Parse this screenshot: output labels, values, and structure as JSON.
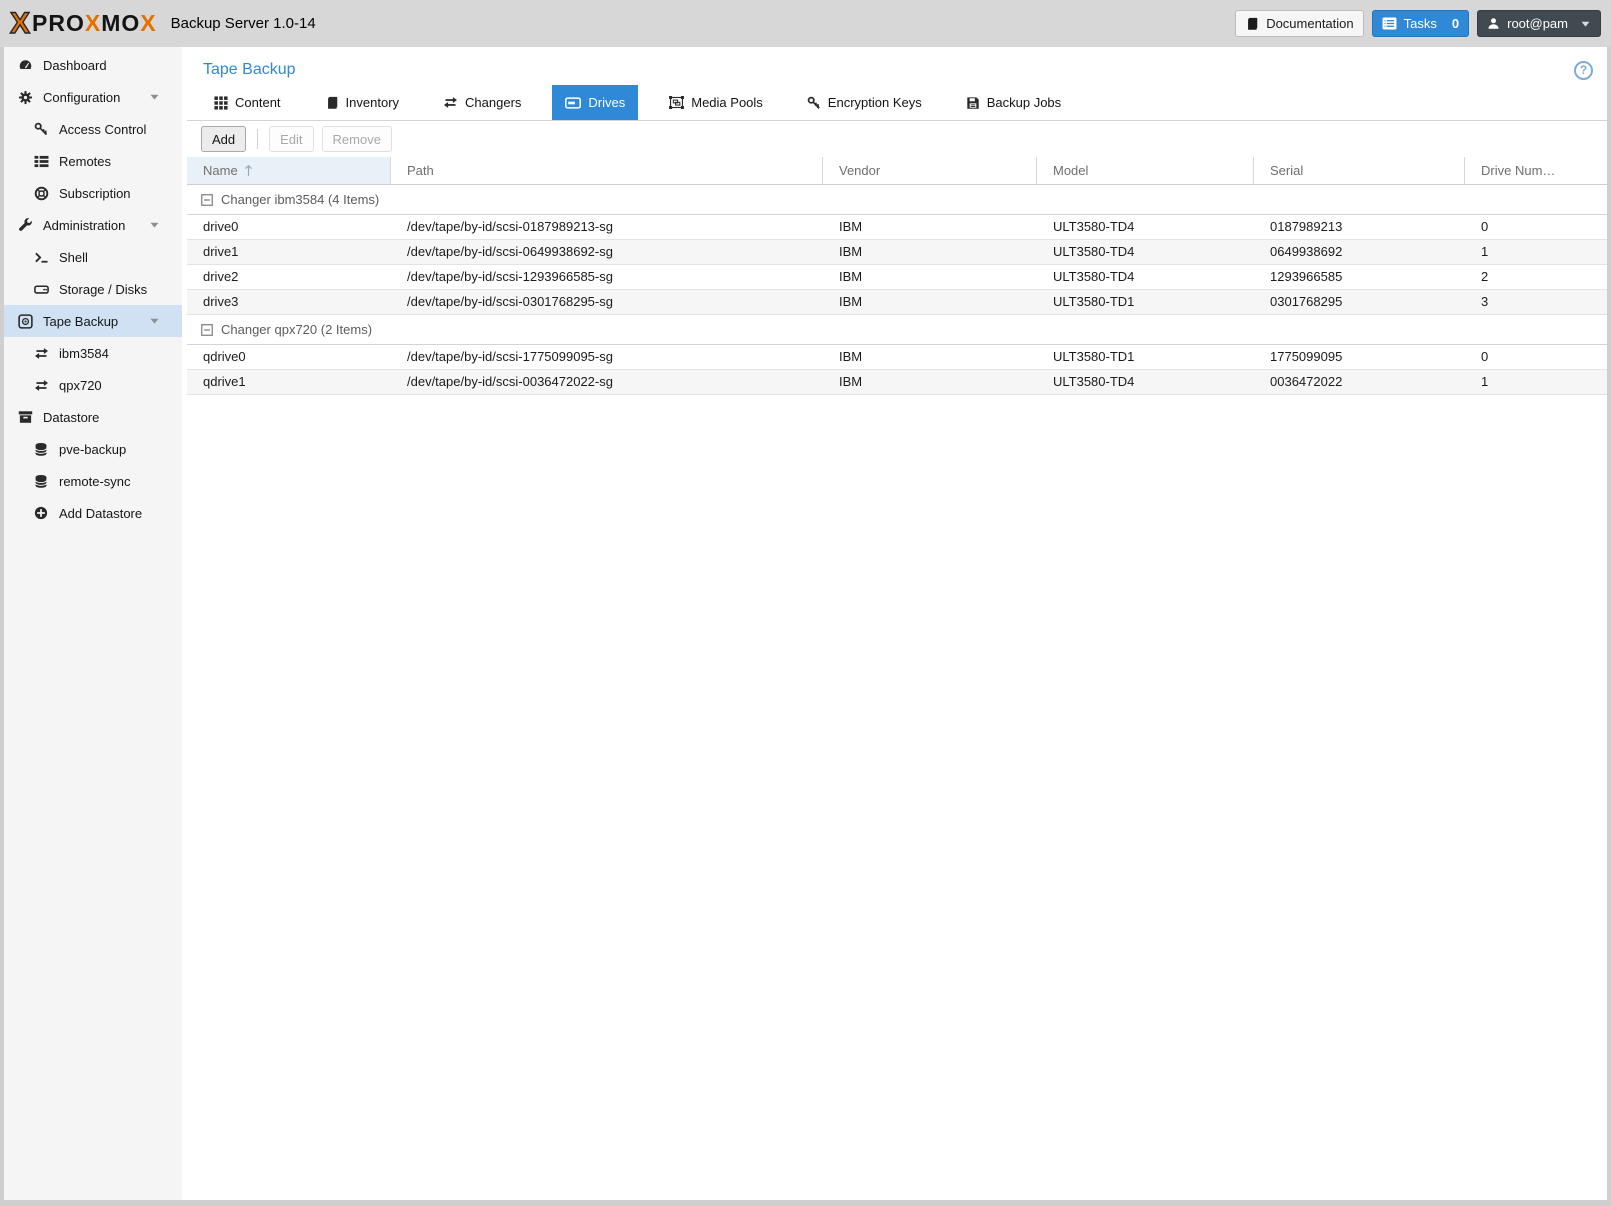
{
  "colors": {
    "accent_blue": "#2f89d6",
    "brand_orange": "#e57000",
    "sidebar_selected": "#cfe1f2"
  },
  "header": {
    "logo_parts": {
      "mark": "X",
      "p1": "PRO",
      "x1": "X",
      "p2": "MO",
      "x2": "X"
    },
    "title": "Backup Server 1.0-14",
    "documentation_label": "Documentation",
    "tasks_label": "Tasks",
    "tasks_count": "0",
    "user_label": "root@pam"
  },
  "sidebar": {
    "items": [
      {
        "label": "Dashboard",
        "icon": "tachometer-icon"
      },
      {
        "label": "Configuration",
        "icon": "cogs-icon"
      },
      {
        "label": "Access Control",
        "icon": "key-icon"
      },
      {
        "label": "Remotes",
        "icon": "list-icon"
      },
      {
        "label": "Subscription",
        "icon": "support-icon"
      },
      {
        "label": "Administration",
        "icon": "wrench-icon"
      },
      {
        "label": "Shell",
        "icon": "terminal-icon"
      },
      {
        "label": "Storage / Disks",
        "icon": "hdd-icon"
      },
      {
        "label": "Tape Backup",
        "icon": "tape-cartridge-icon",
        "selected": true
      },
      {
        "label": "ibm3584",
        "icon": "exchange-icon"
      },
      {
        "label": "qpx720",
        "icon": "exchange-icon"
      },
      {
        "label": "Datastore",
        "icon": "archive-icon"
      },
      {
        "label": "pve-backup",
        "icon": "database-icon"
      },
      {
        "label": "remote-sync",
        "icon": "database-icon"
      },
      {
        "label": "Add Datastore",
        "icon": "plus-circle-icon"
      }
    ]
  },
  "main": {
    "title": "Tape Backup",
    "tabs": [
      {
        "label": "Content",
        "icon": "grid-icon"
      },
      {
        "label": "Inventory",
        "icon": "book-icon"
      },
      {
        "label": "Changers",
        "icon": "exchange-icon"
      },
      {
        "label": "Drives",
        "icon": "tape-drive-icon",
        "selected": true
      },
      {
        "label": "Media Pools",
        "icon": "object-group-icon"
      },
      {
        "label": "Encryption Keys",
        "icon": "key-icon"
      },
      {
        "label": "Backup Jobs",
        "icon": "save-icon"
      }
    ],
    "toolbar": {
      "add_label": "Add",
      "edit_label": "Edit",
      "remove_label": "Remove"
    },
    "table": {
      "columns": [
        "Name",
        "Path",
        "Vendor",
        "Model",
        "Serial",
        "Drive Num…"
      ],
      "sorted_column": "Name",
      "sort_direction": "ascending",
      "groups": [
        {
          "label": "Changer ibm3584 (4 Items)",
          "rows": [
            {
              "name": "drive0",
              "path": "/dev/tape/by-id/scsi-0187989213-sg",
              "vendor": "IBM",
              "model": "ULT3580-TD4",
              "serial": "0187989213",
              "drive_num": "0"
            },
            {
              "name": "drive1",
              "path": "/dev/tape/by-id/scsi-0649938692-sg",
              "vendor": "IBM",
              "model": "ULT3580-TD4",
              "serial": "0649938692",
              "drive_num": "1"
            },
            {
              "name": "drive2",
              "path": "/dev/tape/by-id/scsi-1293966585-sg",
              "vendor": "IBM",
              "model": "ULT3580-TD4",
              "serial": "1293966585",
              "drive_num": "2"
            },
            {
              "name": "drive3",
              "path": "/dev/tape/by-id/scsi-0301768295-sg",
              "vendor": "IBM",
              "model": "ULT3580-TD1",
              "serial": "0301768295",
              "drive_num": "3"
            }
          ]
        },
        {
          "label": "Changer qpx720 (2 Items)",
          "rows": [
            {
              "name": "qdrive0",
              "path": "/dev/tape/by-id/scsi-1775099095-sg",
              "vendor": "IBM",
              "model": "ULT3580-TD1",
              "serial": "1775099095",
              "drive_num": "0"
            },
            {
              "name": "qdrive1",
              "path": "/dev/tape/by-id/scsi-0036472022-sg",
              "vendor": "IBM",
              "model": "ULT3580-TD4",
              "serial": "0036472022",
              "drive_num": "1"
            }
          ]
        }
      ]
    }
  }
}
